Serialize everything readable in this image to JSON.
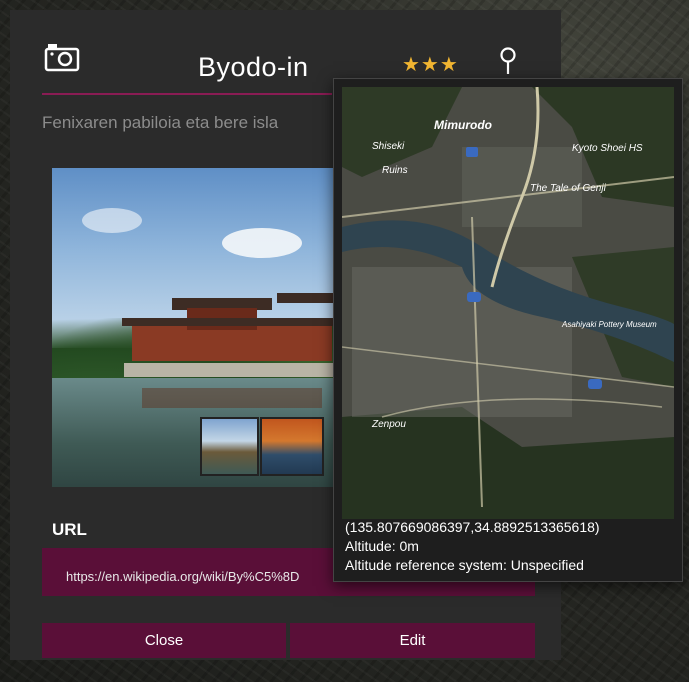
{
  "header": {
    "title": "Byodo-in",
    "stars": "★★★",
    "camera_icon": "camera-icon",
    "pin_icon": "map-pin-icon"
  },
  "subtitle": "Fenixaren pabiloia eta bere isla",
  "url_section": {
    "label": "URL",
    "value": "https://en.wikipedia.org/wiki/By%C5%8D"
  },
  "buttons": {
    "close": "Close",
    "edit": "Edit"
  },
  "map_popup": {
    "labels": {
      "shisekiruins": "Shiseki",
      "ujikami": "Ruins",
      "mimurodo": "Mimurodo",
      "kyoto_shoei": "Kyoto Shoei HS",
      "tale_of_genji": "The Tale of Genji",
      "asahiyaki": "Asahiyaki Pottery Museum",
      "zenpou": "Zenpou"
    },
    "coordinates": "(135.807669086397,34.8892513365618)",
    "altitude": "Altitude: 0m",
    "altitude_ref": "Altitude reference system: Unspecified"
  },
  "colors": {
    "accent": "#5a0f38",
    "accent_line": "#8a1c54",
    "stars": "#f2b632",
    "panel": "#2b2b2b"
  }
}
